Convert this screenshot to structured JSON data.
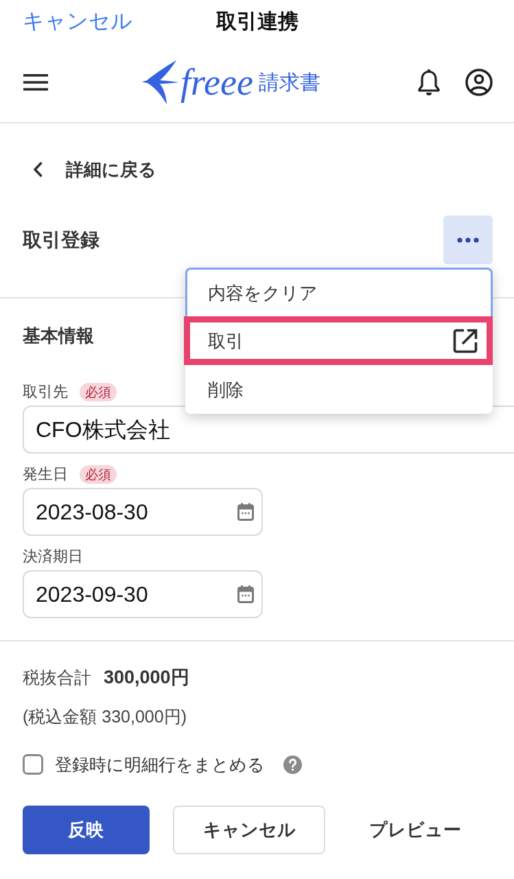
{
  "nav_bar": {
    "cancel": "キャンセル",
    "title": "取引連携"
  },
  "header": {
    "logo_text": "freee",
    "logo_product": "請求書"
  },
  "back_link": {
    "label": "詳細に戻る"
  },
  "page_header": {
    "title": "取引登録"
  },
  "menu": {
    "open": true,
    "items": [
      {
        "label": "内容をクリア",
        "kind": "action",
        "focused": true,
        "highlighted": false
      },
      {
        "label": "取引",
        "kind": "external",
        "focused": false,
        "highlighted": true
      },
      {
        "label": "削除",
        "kind": "action",
        "focused": false,
        "highlighted": false
      }
    ]
  },
  "basic_info": {
    "title": "基本情報",
    "fields": [
      {
        "label": "取引先",
        "badge": "必須",
        "kind": "text",
        "value": "CFO株式会社"
      },
      {
        "label": "発生日",
        "badge": "必須",
        "kind": "date",
        "value": "2023-08-30"
      },
      {
        "label": "決済期日",
        "kind": "date",
        "value": "2023-09-30"
      }
    ]
  },
  "totals": {
    "subtotal_label": "税抜合計",
    "subtotal_value": "300,000円",
    "tax_included": "(税込金額 330,000円)"
  },
  "merge_option": {
    "label": "登録時に明細行をまとめる",
    "checked": false
  },
  "buttons": [
    {
      "label": "反映",
      "kind": "primary"
    },
    {
      "label": "キャンセル",
      "kind": "secondary"
    },
    {
      "label": "プレビュー",
      "kind": "text"
    }
  ]
}
